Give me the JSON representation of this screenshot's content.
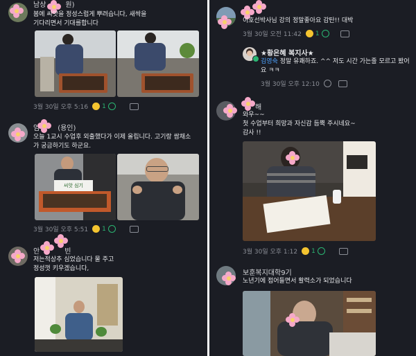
{
  "left": {
    "posts": [
      {
        "author": "남상",
        "author_suffix": "원)",
        "text": "봄에 씨앗을 정성스럽게  뿌려습니다, 새싹을\n기다리면서 기대를합니다",
        "time": "3월 30일 오후 5:16",
        "likes": "1"
      },
      {
        "author": "엄",
        "author_suffix": "(용인)",
        "text": "오늘 1교시 수업후 외출했다가 이제 올립니다. 고기랑 쌈채소\n가 궁금하기도 하군요.",
        "sign_text": "씨앗 심기",
        "time": "3월 30일 오후 5:51",
        "likes": "1"
      },
      {
        "author": "안",
        "author_suffix": "빈",
        "text": "저는적상추 심었습니다 물 주고\n정성껏 키우겠습니다,"
      }
    ]
  },
  "right": {
    "posts": [
      {
        "text": "이호선박사님 강의 정말좋아요 감탄!!  대박",
        "time": "3월 30일 오전 11:42",
        "likes": "1"
      },
      {
        "reply": true,
        "author": "★황은혜 복지사★",
        "mention": "김영숙",
        "text": " 정말 유쾌하죠. ^^ 저도 시간 가는줄 모르고 봤어요 ㅋㅋ",
        "time": "3월 30일 오후 12:10"
      },
      {
        "author_suffix": "해",
        "text": "와우~~\n첫 수업부터  희망과 자신감 듬뿍 주시네요~\n감사 !!",
        "time": "3월 30일 오후 1:12",
        "likes": "1"
      },
      {
        "author": "보훈복지대학9기",
        "text": "노년기에 접어들면서 활력소가 되었습니다"
      }
    ]
  },
  "colors": {
    "background": "#1b1d24",
    "accent_green": "#2bb673",
    "mention_blue": "#4ea3ff",
    "flower_pink": "#f6a9c9"
  }
}
